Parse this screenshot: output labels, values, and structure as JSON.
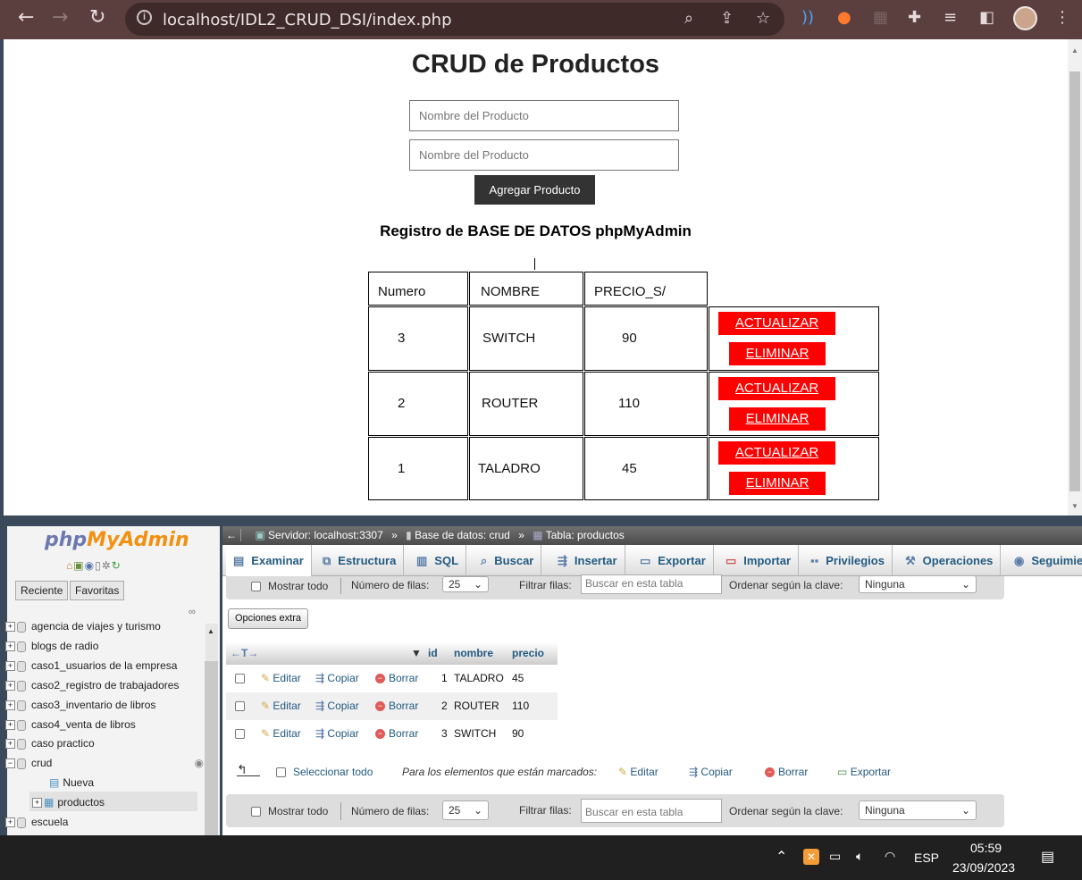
{
  "browser": {
    "url": "localhost/IDL2_CRUD_DSI/index.php",
    "back": "←",
    "forward": "→",
    "reload": "↻",
    "info": "i"
  },
  "app": {
    "title": "CRUD de Productos",
    "input1_placeholder": "Nombre del Producto",
    "input2_placeholder": "Nombre del Producto",
    "add_button": "Agregar Producto",
    "subtitle": "Registro de BASE DE DATOS phpMyAdmin",
    "headers": [
      "Numero",
      "NOMBRE",
      "PRECIO_S/"
    ],
    "rows": [
      {
        "num": "3",
        "name": "SWITCH",
        "price": "90"
      },
      {
        "num": "2",
        "name": "ROUTER",
        "price": "110"
      },
      {
        "num": "1",
        "name": "TALADRO",
        "price": "45"
      }
    ],
    "update_label": "ACTUALIZAR",
    "delete_label": "ELIMINAR"
  },
  "pma": {
    "logo_php": "php",
    "logo_myadmin": "MyAdmin",
    "recent": "Reciente",
    "favorites": "Favoritas",
    "databases": [
      "agencia de viajes y turismo",
      "blogs de radio",
      "caso1_usuarios de la empresa",
      "caso2_registro de trabajadores",
      "caso3_inventario de libros",
      "caso4_venta de libros",
      "caso practico",
      "crud",
      "Nueva",
      "productos",
      "escuela"
    ],
    "breadcrumb": {
      "server": "Servidor: localhost:3307",
      "database": "Base de datos: crud",
      "table": "Tabla: productos",
      "sep": "»"
    },
    "tabs": [
      "Examinar",
      "Estructura",
      "SQL",
      "Buscar",
      "Insertar",
      "Exportar",
      "Importar",
      "Privilegios",
      "Operaciones",
      "Seguimie"
    ],
    "show_all": "Mostrar todo",
    "rows_label": "Número de filas:",
    "rows_value": "25",
    "filter_label": "Filtrar filas:",
    "filter_placeholder": "Buscar en esta tabla",
    "order_label": "Ordenar según la clave:",
    "order_value": "Ninguna",
    "extra_options": "Opciones extra",
    "columns": [
      "id",
      "nombre",
      "precio"
    ],
    "table_rows": [
      {
        "id": "1",
        "nombre": "TALADRO",
        "precio": "45"
      },
      {
        "id": "2",
        "nombre": "ROUTER",
        "precio": "110"
      },
      {
        "id": "3",
        "nombre": "SWITCH",
        "precio": "90"
      }
    ],
    "edit": "Editar",
    "copy": "Copiar",
    "delete": "Borrar",
    "select_all": "Seleccionar todo",
    "with_selected": "Para los elementos que están marcados:",
    "export": "Exportar"
  },
  "taskbar": {
    "lang": "ESP",
    "time": "05:59",
    "date": "23/09/2023"
  }
}
